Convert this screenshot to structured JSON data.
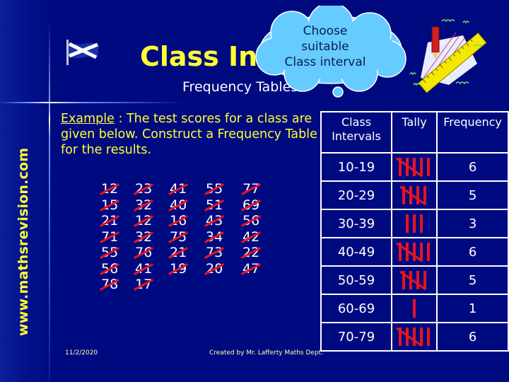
{
  "slide": {
    "title": "Class Intervals",
    "title_visible": "Class In",
    "subtitle": "Frequency Tables",
    "side_banner": "www.mathsrevision.com",
    "callout": [
      "Choose",
      "suitable",
      "Class interval"
    ],
    "colors": {
      "background": "#000a80",
      "title": "#ffff33",
      "callout_fill": "#66ccff",
      "tally_marks": "#e8141e"
    }
  },
  "example": {
    "label": "Example",
    "text": " : The test scores for a class are given below. Construct a Frequency Table for the results."
  },
  "scores": {
    "columns": [
      [
        "12",
        "15",
        "21",
        "71",
        "55",
        "56",
        "78"
      ],
      [
        "23",
        "32",
        "12",
        "32",
        "76",
        "41",
        "17"
      ],
      [
        "41",
        "40",
        "16",
        "75",
        "21",
        "19"
      ],
      [
        "55",
        "51",
        "43",
        "34",
        "73",
        "20"
      ],
      [
        "77",
        "69",
        "56",
        "42",
        "22",
        "47"
      ]
    ],
    "all_crossed_out": true
  },
  "table": {
    "headers": [
      "Class Intervals",
      "Tally",
      "Frequency"
    ],
    "header_lines": [
      [
        "Class",
        "Intervals"
      ],
      [
        "Tally"
      ],
      [
        "Frequency"
      ]
    ],
    "rows": [
      {
        "interval": "10-19",
        "tally": 6,
        "frequency": "6"
      },
      {
        "interval": "20-29",
        "tally": 5,
        "frequency": "5"
      },
      {
        "interval": "30-39",
        "tally": 3,
        "frequency": "3"
      },
      {
        "interval": "40-49",
        "tally": 6,
        "frequency": "6"
      },
      {
        "interval": "50-59",
        "tally": 5,
        "frequency": "5"
      },
      {
        "interval": "60-69",
        "tally": 1,
        "frequency": "1"
      },
      {
        "interval": "70-79",
        "tally": 6,
        "frequency": "6"
      }
    ]
  },
  "footer": {
    "date": "11/2/2020",
    "credit": "Created by Mr. Lafferty Maths Dept."
  },
  "icons": {
    "flag": "scotland-flag-icon",
    "art": "pencil-ruler-icon",
    "callout": "thought-cloud-icon"
  }
}
